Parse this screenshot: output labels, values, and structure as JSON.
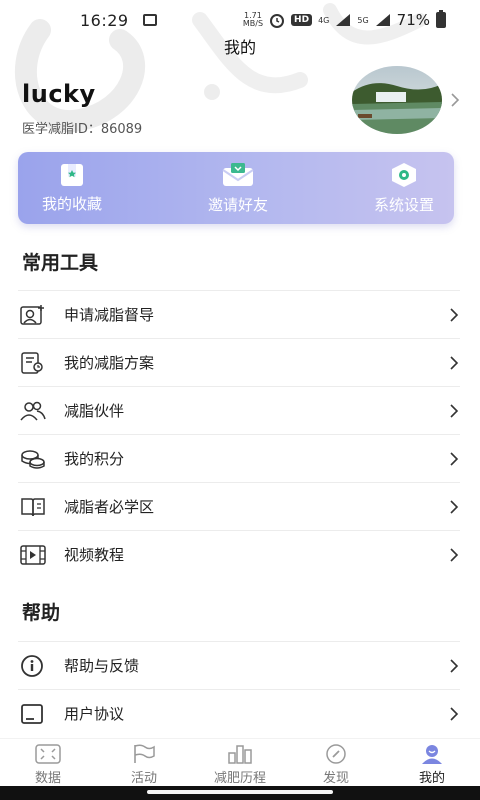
{
  "status_bar": {
    "time": "16:29",
    "net_speed_value": "1.71",
    "net_speed_unit": "MB/S",
    "hd": "HD",
    "sig1": "4G",
    "sig2": "5G",
    "battery": "71%"
  },
  "nav": {
    "title": "我的"
  },
  "profile": {
    "name": "lucky",
    "id_label": "医学减脂ID：86089"
  },
  "quick_actions": [
    {
      "label": "我的收藏",
      "icon": "bookmark-icon"
    },
    {
      "label": "邀请好友",
      "icon": "invite-envelope-icon"
    },
    {
      "label": "系统设置",
      "icon": "settings-hexagon-icon"
    }
  ],
  "tools": {
    "title": "常用工具",
    "items": [
      {
        "label": "申请减脂督导",
        "icon": "user-add-icon"
      },
      {
        "label": "我的减脂方案",
        "icon": "plan-document-icon"
      },
      {
        "label": "减脂伙伴",
        "icon": "partners-icon"
      },
      {
        "label": "我的积分",
        "icon": "coins-icon"
      },
      {
        "label": "减脂者必学区",
        "icon": "book-icon"
      },
      {
        "label": "视频教程",
        "icon": "video-icon"
      }
    ]
  },
  "help": {
    "title": "帮助",
    "items": [
      {
        "label": "帮助与反馈",
        "icon": "info-icon"
      },
      {
        "label": "用户协议",
        "icon": "agreement-icon"
      }
    ]
  },
  "tabs": [
    {
      "label": "数据",
      "icon": "data-icon",
      "active": false
    },
    {
      "label": "活动",
      "icon": "flag-icon",
      "active": false
    },
    {
      "label": "减肥历程",
      "icon": "bar-chart-icon",
      "active": false
    },
    {
      "label": "发现",
      "icon": "compass-icon",
      "active": false
    },
    {
      "label": "我的",
      "icon": "user-icon",
      "active": true
    }
  ],
  "colors": {
    "accent": "#9aa3ec",
    "active_tab": "#7b86e0",
    "text": "#222222"
  }
}
